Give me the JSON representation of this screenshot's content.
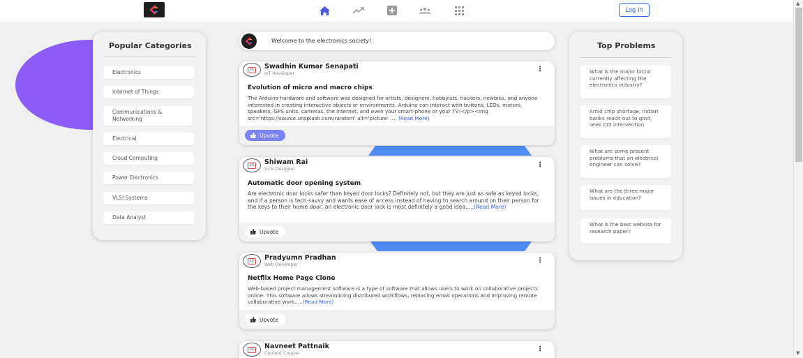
{
  "nav": {
    "icons": [
      "home-icon",
      "trending-icon",
      "add-post-icon",
      "people-icon",
      "grid-icon"
    ],
    "login_label": "Log In",
    "active_color": "#4f5bd5"
  },
  "welcome": {
    "text": "Welcome to the electronics society!"
  },
  "categories": {
    "title": "Popular Categories",
    "items": [
      "Electronics",
      "Internet of Things",
      "Communications & Networking",
      "Electrical",
      "Cloud Computing",
      "Power Electronics",
      "VLSI Systems",
      "Data Analyst"
    ]
  },
  "problems": {
    "title": "Top Problems",
    "items": [
      "What is the major factor currently affecting the electronics industry?",
      "Amid chip shortage, Indian banks reach out to govt, seek CCI intervention",
      "What are some present problems that an electrical engineer can solve?",
      "What are the three major issues in education?",
      "What is the best website for research paper?"
    ]
  },
  "posts": [
    {
      "author": "Swadhin Kumar Senapati",
      "role": "IoT developer",
      "title": "Evolution of micro and macro chips",
      "body": "The Arduino hardware and software was designed for artists, designers, hobbyists, hackers, newbies, and anyone interested in creating interactive objects or environments. Arduino can interact with buttons, LEDs, motors, speakers, GPS units, cameras, the internet, and even your smart-phone or your TV!</p><img src='https://source.unsplash.com/random' alt='picture' ....",
      "read_more": "(Read More)",
      "upvote": "Upvote",
      "upvoted": true
    },
    {
      "author": "Shiwam Rai",
      "role": "VLSI Designer",
      "title": "Automatic door opening system",
      "body": "Are electronic door locks safer than keyed door locks? Definitely not, but they are just as safe as keyed locks, and if a person is tech-savvy and wants ease of access instead of having to search around on their person for the keys to their home door, an electronic door lock is most definitely a good idea.....",
      "read_more": "(Read More)",
      "upvote": "Upvote",
      "upvoted": false
    },
    {
      "author": "Pradyumn Pradhan",
      "role": "Web Developer",
      "title": "Netflix Home Page Clone",
      "body": "Web-based project management software is a type of software that allows users to work on collaborative projects online. This software allows streamlining distributed workflows, replacing email operations and improving remote collaborative work.....",
      "read_more": "(Read More)",
      "upvote": "Upvote",
      "upvoted": false
    },
    {
      "author": "Navneet Pattnaik",
      "role": "Content Creater"
    }
  ]
}
